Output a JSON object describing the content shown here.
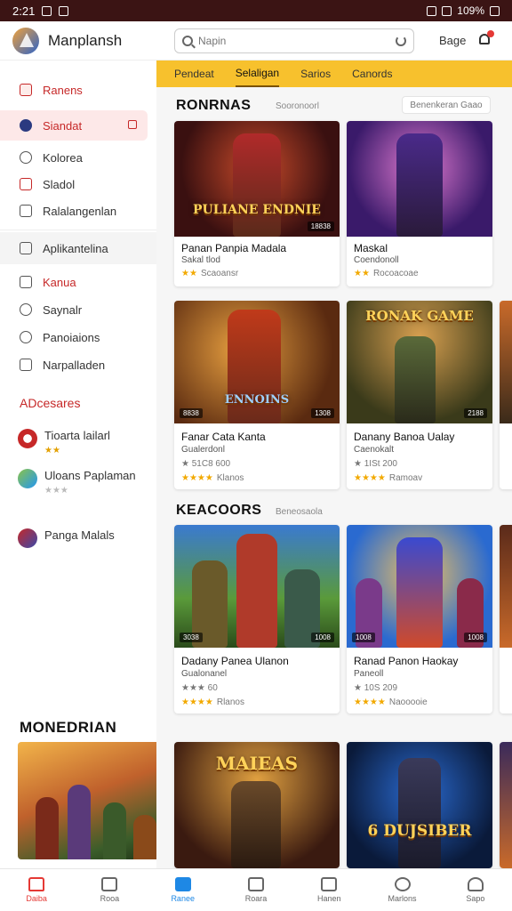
{
  "status": {
    "time": "2:21",
    "right": "109%"
  },
  "header": {
    "app_title": "Manplansh",
    "search_placeholder": "Napin",
    "link": "Bage"
  },
  "sidebar": {
    "items": [
      {
        "label": "Ranens"
      },
      {
        "label": "Siandat"
      },
      {
        "label": "Kolorea"
      },
      {
        "label": "Sladol"
      },
      {
        "label": "Ralalangenlan"
      },
      {
        "label": "Aplikantelina"
      },
      {
        "label": "Kanua"
      },
      {
        "label": "Saynalr"
      },
      {
        "label": "Panoiaions"
      },
      {
        "label": "Narpalladen"
      }
    ],
    "friends_heading": "ADcesares",
    "friends": [
      {
        "name": "Tioarta lailarl",
        "stars": "★★"
      },
      {
        "name": "Uloans Paplaman",
        "stars": "★★★"
      },
      {
        "name": "Panga Malals",
        "stars": ""
      }
    ],
    "big_heading": "MONEDRIAN"
  },
  "tabs": [
    "Pendeat",
    "Selaligan",
    "Sarios",
    "Canords"
  ],
  "sections": {
    "first": {
      "title": "RONRNAS",
      "sub": "Sooronoorl",
      "pill": "Benenkeran Gaao"
    },
    "second": {
      "title": "KEACOORS",
      "sub": "Beneosaola"
    }
  },
  "cards_row1": [
    {
      "title": "Panan Panpia Madala",
      "sub1": "Sakal tlod",
      "sub2": "Scaoansr",
      "stars": "★★",
      "badge": "18838",
      "art": "PULIANE ENDNIE"
    },
    {
      "title": "Maskal",
      "sub1": "Coendonoll",
      "sub2": "Rocoacoae",
      "stars": "★★",
      "badge": "",
      "art": ""
    }
  ],
  "cards_row2": [
    {
      "title": "Fanar Cata Kanta",
      "sub1": "Gualerdonl",
      "sub2": "Klanos",
      "meta": "★ 51C8 600",
      "stars": "★★★★",
      "badge": "1308",
      "badge_l": "8838",
      "art": "ENNOINS"
    },
    {
      "title": "Danany Banoa Ualay",
      "sub1": "Caenokalt",
      "sub2": "Ramoav",
      "meta": "★ 1ISt 200",
      "stars": "★★★★",
      "badge": "2188",
      "badge_l": "",
      "art": "RONAK GAME"
    }
  ],
  "cards_row3": [
    {
      "title": "Dadany Panea Ulanon",
      "sub1": "Gualonanel",
      "sub2": "Rlanos",
      "meta": "★★★ 60",
      "stars": "★★★★",
      "badge": "1008",
      "badge_l": "3038"
    },
    {
      "title": "Ranad Panon Haokay",
      "sub1": "Paneoll",
      "sub2": "Naooooie",
      "meta": "★ 10S 209",
      "stars": "★★★★",
      "badge": "1008",
      "badge_l": "1008"
    }
  ],
  "cards_row4": [
    {
      "art": "MAIEAS"
    },
    {
      "art": "6 DUJSIBER"
    }
  ],
  "bottom_nav": [
    "Daiba",
    "Rooa",
    "Ranee",
    "Roara",
    "Hanen",
    "Marlons",
    "Sapo"
  ],
  "colors": {
    "accent": "#f7c12d",
    "brand_red": "#c62828",
    "nav_selected": "#1e88e5"
  }
}
